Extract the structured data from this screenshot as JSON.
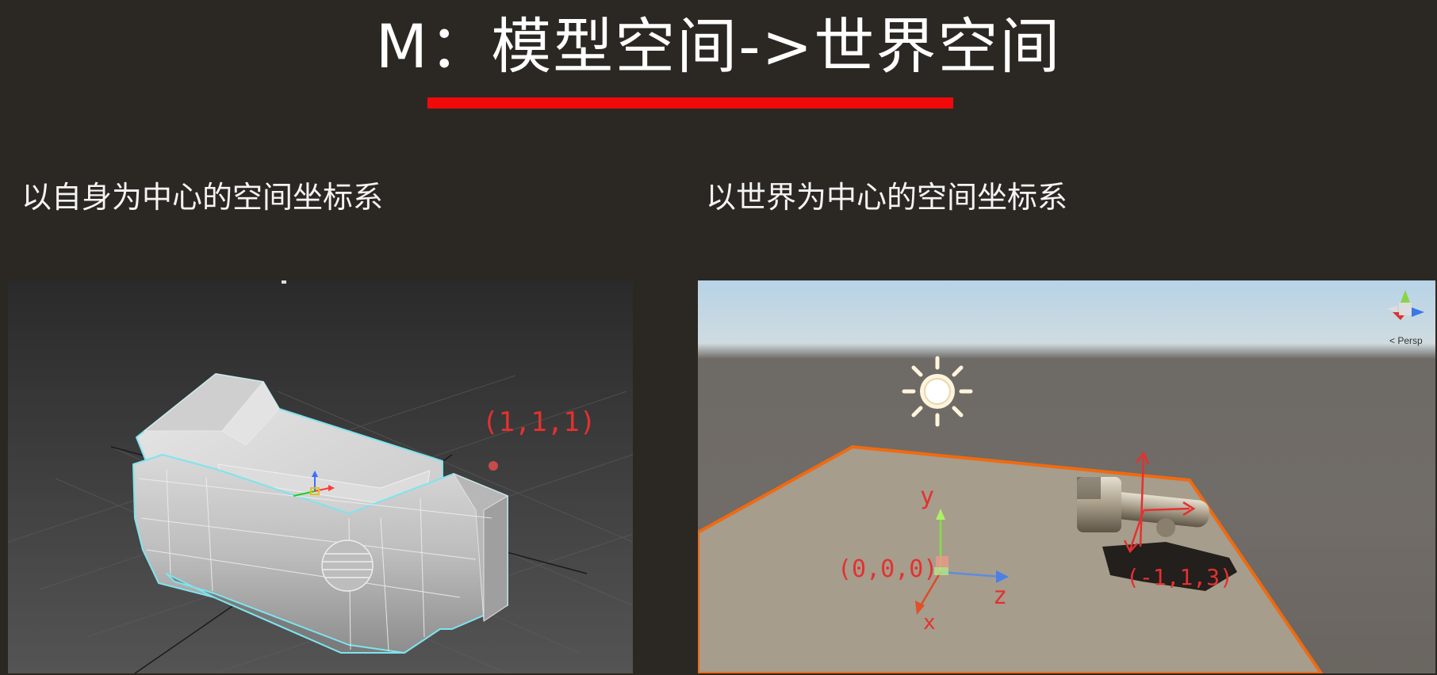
{
  "slide": {
    "title": "M：模型空间->世界空间",
    "accent_color": "#f20a0a"
  },
  "left": {
    "caption": "以自身为中心的空间坐标系",
    "annotation": "(1,1,1)",
    "object_icon": "boxy-3d-model-wireframe",
    "gizmo_icon": "local-axis-gizmo-icon"
  },
  "right": {
    "caption": "以世界为中心的空间坐标系",
    "origin_label": "(0,0,0)",
    "object_label": "(-1,1,3)",
    "axis_y": "y",
    "axis_z": "z",
    "axis_x": "x",
    "view_label": "< Persp",
    "sun_icon": "directional-light-sun-icon",
    "orientation_gizmo_icon": "scene-orientation-gizmo-icon"
  }
}
